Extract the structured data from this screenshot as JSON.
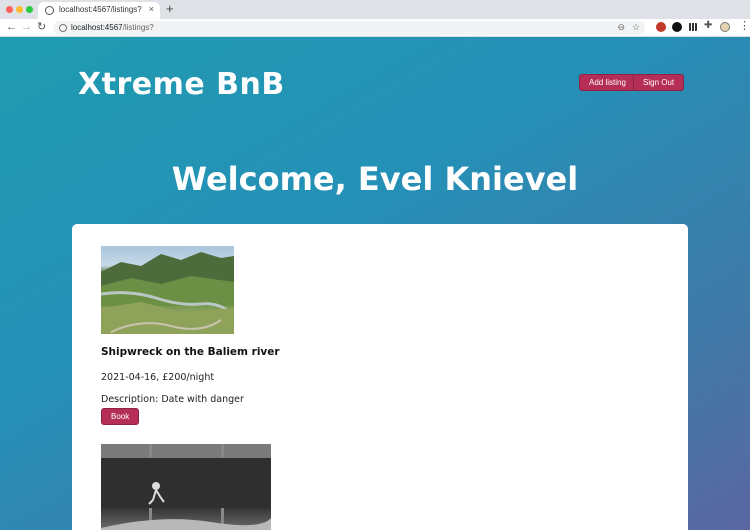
{
  "browser": {
    "tab_title": "localhost:4567/listings?",
    "tab_close": "×",
    "new_tab": "+",
    "url_host": "localhost:4567",
    "url_path": "/listings?"
  },
  "header": {
    "brand": "Xtreme BnB",
    "add_listing_label": "Add listing",
    "sign_out_label": "Sign Out"
  },
  "welcome": "Welcome, Evel Knievel",
  "listings": [
    {
      "title": "Shipwreck on the Baliem river",
      "meta": "2021-04-16, £200/night",
      "description": "Description: Date with danger",
      "book_label": "Book"
    }
  ],
  "colors": {
    "accent": "#b52e55",
    "gradient_start": "#1f9bb0",
    "gradient_end": "#5a67a0"
  }
}
